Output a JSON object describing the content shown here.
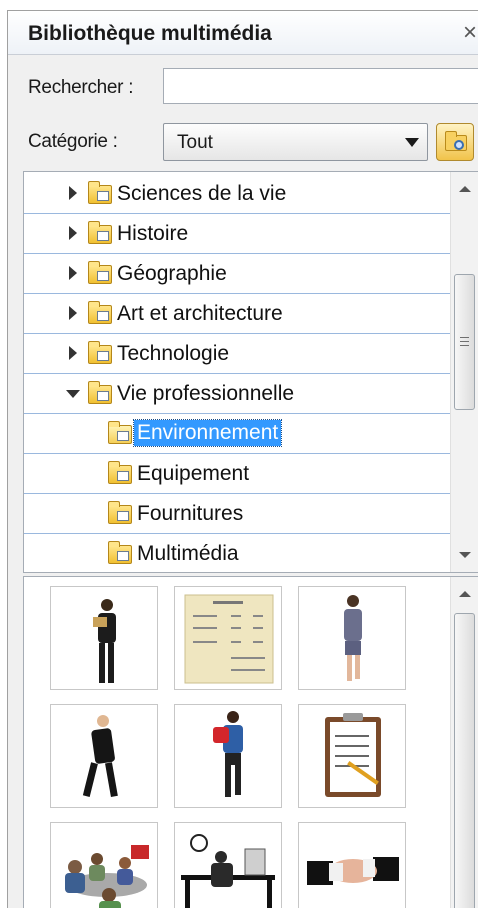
{
  "header": {
    "title": "Bibliothèque multimédia",
    "close_glyph": "×"
  },
  "search": {
    "label": "Rechercher :",
    "value": "",
    "placeholder": ""
  },
  "category": {
    "label": "Catégorie :",
    "selected": "Tout"
  },
  "tree": {
    "items": [
      {
        "label": "Sciences de la vie",
        "state": "collapsed",
        "level": 0
      },
      {
        "label": "Histoire",
        "state": "collapsed",
        "level": 0
      },
      {
        "label": "Géographie",
        "state": "collapsed",
        "level": 0
      },
      {
        "label": "Art et architecture",
        "state": "collapsed",
        "level": 0
      },
      {
        "label": "Technologie",
        "state": "collapsed",
        "level": 0
      },
      {
        "label": "Vie professionnelle",
        "state": "expanded",
        "level": 0
      },
      {
        "label": "Environnement",
        "state": "selected",
        "level": 1
      },
      {
        "label": "Equipement",
        "state": "leaf",
        "level": 1
      },
      {
        "label": "Fournitures",
        "state": "leaf",
        "level": 1
      },
      {
        "label": "Multimédia",
        "state": "leaf",
        "level": 1
      }
    ]
  },
  "thumbnails": [
    {
      "icon": "businesswoman-reading-icon"
    },
    {
      "icon": "invoice-document-icon"
    },
    {
      "icon": "businesswoman-walking-icon"
    },
    {
      "icon": "businessman-walking-icon"
    },
    {
      "icon": "woman-carrying-folder-icon"
    },
    {
      "icon": "clipboard-checklist-icon"
    },
    {
      "icon": "meeting-table-icon"
    },
    {
      "icon": "office-worker-desk-icon"
    },
    {
      "icon": "handshake-icon"
    }
  ],
  "colors": {
    "selection": "#3399ff",
    "row_border": "#9ab8de",
    "folder": "#f1c032"
  }
}
